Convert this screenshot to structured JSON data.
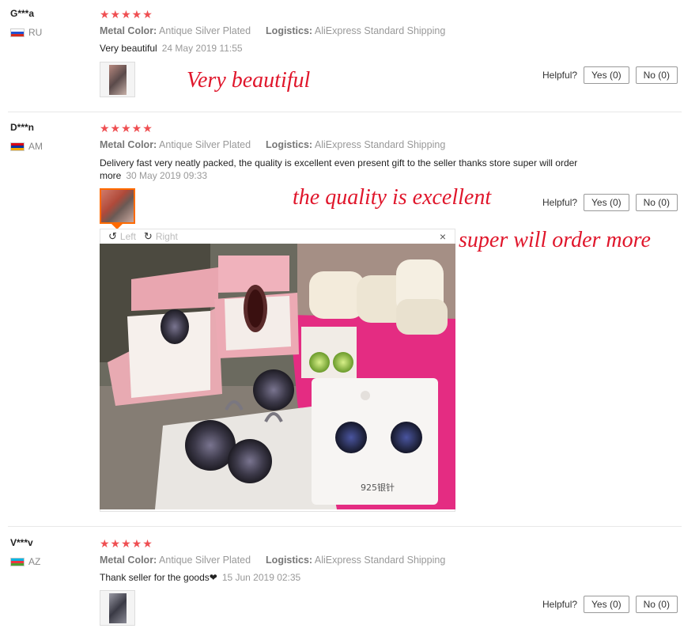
{
  "attr_labels": {
    "color": "Metal Color:",
    "logistics": "Logistics:"
  },
  "helpful": {
    "label": "Helpful?"
  },
  "reviews": [
    {
      "user": "G***a",
      "country": "RU",
      "rating": "★★★★★",
      "color_value": "Antique Silver Plated",
      "logistics_value": "AliExpress Standard Shipping",
      "text": "Very beautiful",
      "date": "24 May 2019 11:55",
      "yes": "Yes (0)",
      "no": "No (0)"
    },
    {
      "user": "D***n",
      "country": "AM",
      "rating": "★★★★★",
      "color_value": "Antique Silver Plated",
      "logistics_value": "AliExpress Standard Shipping",
      "text": "Delivery fast very neatly packed, the quality is excellent even present gift to the seller thanks store super will order more",
      "date": "30 May 2019 09:33",
      "yes": "Yes (0)",
      "no": "No (0)"
    },
    {
      "user": "V***v",
      "country": "AZ",
      "rating": "★★★★★",
      "color_value": "Antique Silver Plated",
      "logistics_value": "AliExpress Standard Shipping",
      "text": "Thank seller for the goods❤",
      "date": "15 Jun 2019 02:35",
      "yes": "Yes (0)",
      "no": "No (0)"
    }
  ],
  "viewer": {
    "rotate_left": "Left",
    "rotate_right": "Right",
    "close": "×",
    "photo_text": "925银针"
  },
  "annotations": {
    "a1": "Very beautiful",
    "a2": "the quality is excellent",
    "a3": "super will order more"
  },
  "colors": {
    "stars": "#ef4f52",
    "annotation": "#e0162b",
    "active_thumb": "#ff6a00"
  }
}
